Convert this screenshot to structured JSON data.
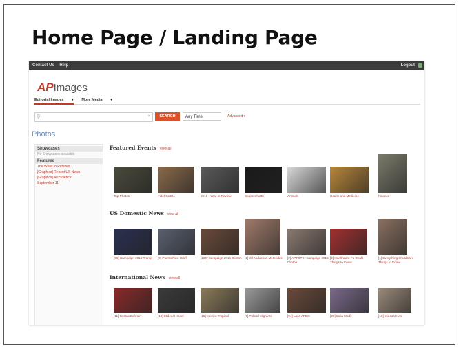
{
  "slide": {
    "title": "Home Page / Landing Page"
  },
  "app": {
    "topbar": {
      "links": [
        "Contact Us",
        "Help"
      ],
      "logout": "Logout"
    },
    "logo": {
      "ap": "AP",
      "images": "Images"
    },
    "tabs": [
      "Editorial Images",
      "More Media"
    ],
    "search": {
      "placeholder": "",
      "button": "SEARCH",
      "time": "Any Time",
      "advanced": "Advanced"
    },
    "page_heading": "Photos",
    "sidebar": {
      "showcases_label": "Showcases",
      "showcases_note": "No Showcases available",
      "features_label": "Features",
      "features": [
        "The Week in Pictures",
        "[Graphics] Recent US News",
        "[Graphics] AP Science",
        "September 11"
      ]
    },
    "sections": [
      {
        "title": "Featured Events",
        "view_all": "view all",
        "items": [
          {
            "caption": "Top Photos",
            "color": "#4a4a3c"
          },
          {
            "caption": "Fidel Castro",
            "color": "#8a6a4a"
          },
          {
            "caption": "2016 - Year in Review",
            "color": "#5a5a5a"
          },
          {
            "caption": "Space Shuttle",
            "color": "#1a1a1a"
          },
          {
            "caption": "Animals",
            "color": "#d8d8d8"
          },
          {
            "caption": "Health and Medicine",
            "color": "#b8863a"
          },
          {
            "caption": "Finance",
            "color": "#7a7a6a"
          }
        ]
      },
      {
        "title": "US Domestic News",
        "view_all": "view all",
        "items": [
          {
            "caption": "[99] Campaign 2016 Trump",
            "color": "#2a3050"
          },
          {
            "caption": "[9] Puerto Rico Grief",
            "color": "#5a6070"
          },
          {
            "caption": "[100] Campaign 2016 Clinton",
            "color": "#6a4a3a"
          },
          {
            "caption": "[1] Jill Abduction Mercedes",
            "color": "#a07a6a"
          },
          {
            "caption": "[2] APTOPIX Campaign 2016 Clinton",
            "color": "#8a7a70"
          },
          {
            "caption": "[2] Healthcare Fu Deals Things to Know",
            "color": "#a03030"
          },
          {
            "caption": "[1] Everything Shutdown Things to Know",
            "color": "#8a7060"
          }
        ]
      },
      {
        "title": "International News",
        "view_all": "view all",
        "items": [
          {
            "caption": "[11] Russia Bahrain",
            "color": "#8a2a2a"
          },
          {
            "caption": "[19] Mideast Israel",
            "color": "#3a3a3a"
          },
          {
            "caption": "[15] Mexico Tropical",
            "color": "#8a7a5a"
          },
          {
            "caption": "[7] Poland Migrants",
            "color": "#9a9a9a"
          },
          {
            "caption": "[94] Laos APEC",
            "color": "#6a4a3a"
          },
          {
            "caption": "[39] India Modi",
            "color": "#7a6a8a"
          },
          {
            "caption": "[16] Mideast Iran",
            "color": "#9a8a7a"
          }
        ]
      }
    ]
  }
}
